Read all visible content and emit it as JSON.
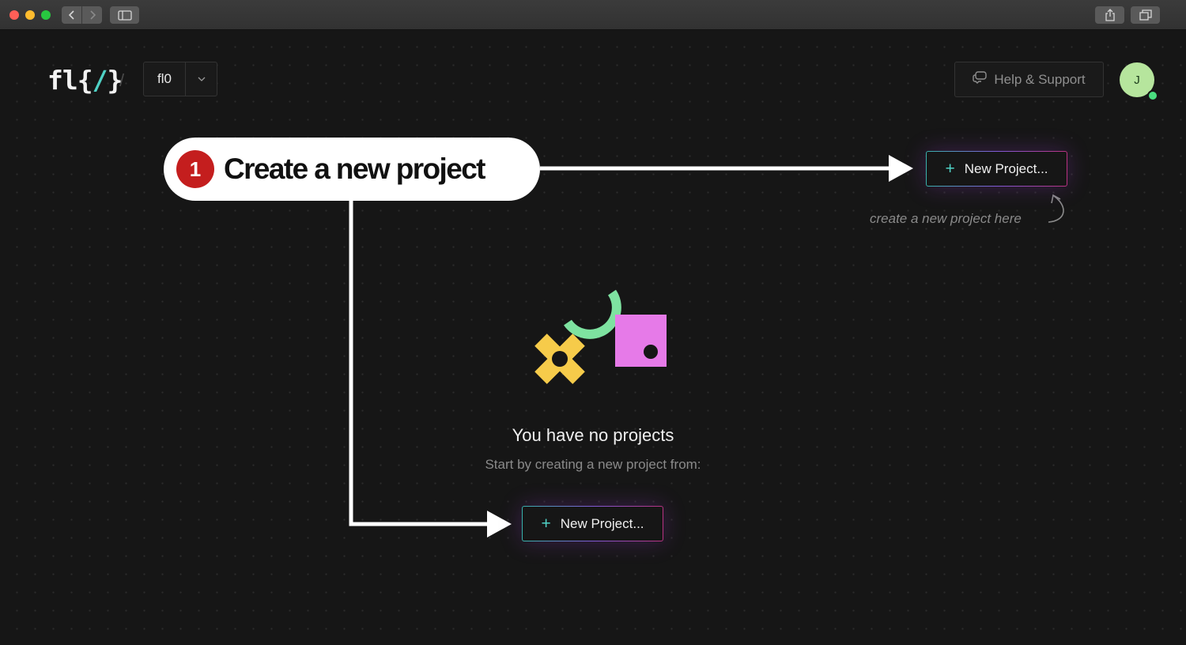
{
  "browser": {
    "back_icon": "chevron-left-icon",
    "forward_icon": "chevron-right-icon",
    "sidebar_icon": "sidebar-icon",
    "share_icon": "share-icon",
    "tabs_icon": "tabs-icon"
  },
  "header": {
    "logo_text": "fl",
    "logo_brace_open": "{",
    "logo_slash": "/",
    "logo_brace_close": "}",
    "breadcrumb_separator": "/",
    "org_name": "fl0",
    "help_label": "Help & Support",
    "avatar_initial": "J"
  },
  "callout": {
    "step": "1",
    "title": "Create a new project"
  },
  "new_project_top": {
    "icon": "+",
    "label": "New Project..."
  },
  "hint_text": "create a new project here",
  "empty_state": {
    "title": "You have no projects",
    "subtitle": "Start by creating a new project from:"
  },
  "new_project_bottom": {
    "icon": "+",
    "label": "New Project..."
  },
  "colors": {
    "background": "#161616",
    "accent_teal": "#4fd1c5",
    "accent_purple": "#805ad5",
    "callout_badge": "#c41e1e",
    "shape_yellow": "#f6cb4a",
    "shape_green": "#7ee2a0",
    "shape_pink": "#e67ae8"
  }
}
